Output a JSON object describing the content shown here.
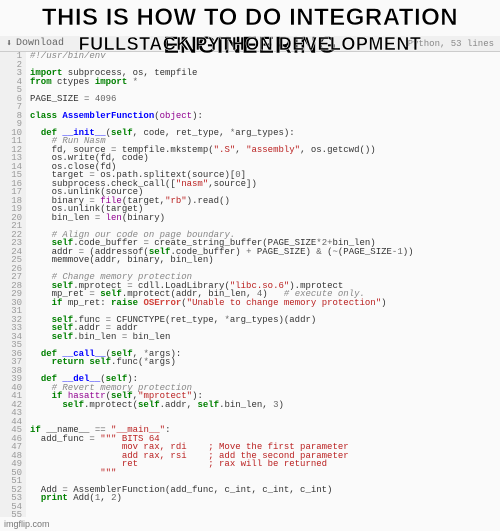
{
  "meme": {
    "line1": "THIS IS HOW TO DO INTEGRATION ENGINEERING",
    "line2": "FULLSTACK PYTHON DEVELOPMENT"
  },
  "toolbar": {
    "download_label": "Download",
    "lang_label": "Python, 53 lines"
  },
  "code": {
    "lines": [
      {
        "n": 1,
        "html": "<span class=\"c-comment\">#!/usr/bin/env</span>"
      },
      {
        "n": 2,
        "html": ""
      },
      {
        "n": 3,
        "html": "<span class=\"c-keyword\">import</span> subprocess, os, tempfile"
      },
      {
        "n": 4,
        "html": "<span class=\"c-keyword\">from</span> ctypes <span class=\"c-keyword\">import</span> <span class=\"c-op\">*</span>"
      },
      {
        "n": 5,
        "html": ""
      },
      {
        "n": 6,
        "html": "PAGE_SIZE <span class=\"c-op\">=</span> <span class=\"c-number\">4096</span>"
      },
      {
        "n": 7,
        "html": ""
      },
      {
        "n": 8,
        "html": "<span class=\"c-keyword\">class</span> <span class=\"c-class\">AssemblerFunction</span>(<span class=\"c-builtin\">object</span>):"
      },
      {
        "n": 9,
        "html": ""
      },
      {
        "n": 10,
        "html": "  <span class=\"c-keyword\">def</span> <span class=\"c-def\">__init__</span>(<span class=\"c-self\">self</span>, code, ret_type, <span class=\"c-op\">*</span>arg_types):"
      },
      {
        "n": 11,
        "html": "    <span class=\"c-comment\"># Run Nasm</span>"
      },
      {
        "n": 12,
        "html": "    fd, source <span class=\"c-op\">=</span> tempfile.mkstemp(<span class=\"c-string\">\".S\"</span>, <span class=\"c-string\">\"assembly\"</span>, os.getcwd())"
      },
      {
        "n": 13,
        "html": "    os.write(fd, code)"
      },
      {
        "n": 14,
        "html": "    os.close(fd)"
      },
      {
        "n": 15,
        "html": "    target <span class=\"c-op\">=</span> os.path.splitext(source)[<span class=\"c-number\">0</span>]"
      },
      {
        "n": 16,
        "html": "    subprocess.check_call([<span class=\"c-string\">\"nasm\"</span>,source])"
      },
      {
        "n": 17,
        "html": "    os.unlink(source)"
      },
      {
        "n": 18,
        "html": "    binary <span class=\"c-op\">=</span> <span class=\"c-builtin\">file</span>(target,<span class=\"c-string\">\"rb\"</span>).read()"
      },
      {
        "n": 19,
        "html": "    os.unlink(target)"
      },
      {
        "n": 20,
        "html": "    bin_len <span class=\"c-op\">=</span> <span class=\"c-builtin\">len</span>(binary)"
      },
      {
        "n": 21,
        "html": ""
      },
      {
        "n": 22,
        "html": "    <span class=\"c-comment\"># Align our code on page boundary.</span>"
      },
      {
        "n": 23,
        "html": "    <span class=\"c-self\">self</span>.code_buffer <span class=\"c-op\">=</span> create_string_buffer(PAGE_SIZE<span class=\"c-op\">*</span><span class=\"c-number\">2</span><span class=\"c-op\">+</span>bin_len)"
      },
      {
        "n": 24,
        "html": "    addr <span class=\"c-op\">=</span> (addressof(<span class=\"c-self\">self</span>.code_buffer) <span class=\"c-op\">+</span> PAGE_SIZE) <span class=\"c-op\">&amp;</span> (<span class=\"c-op\">~</span>(PAGE_SIZE<span class=\"c-op\">-</span><span class=\"c-number\">1</span>))"
      },
      {
        "n": 25,
        "html": "    memmove(addr, binary, bin_len)"
      },
      {
        "n": 26,
        "html": ""
      },
      {
        "n": 27,
        "html": "    <span class=\"c-comment\"># Change memory protection</span>"
      },
      {
        "n": 28,
        "html": "    <span class=\"c-self\">self</span>.mprotect <span class=\"c-op\">=</span> cdll.LoadLibrary(<span class=\"c-string\">\"libc.so.6\"</span>).mprotect"
      },
      {
        "n": 29,
        "html": "    mp_ret <span class=\"c-op\">=</span> <span class=\"c-self\">self</span>.mprotect(addr, bin_len, <span class=\"c-number\">4</span>)   <span class=\"c-comment\"># execute only.</span>"
      },
      {
        "n": 30,
        "html": "    <span class=\"c-keyword\">if</span> mp_ret: <span class=\"c-keyword\">raise</span> <span class=\"c-error\">OSError</span>(<span class=\"c-string\">\"Unable to change memory protection\"</span>)"
      },
      {
        "n": 31,
        "html": ""
      },
      {
        "n": 32,
        "html": "    <span class=\"c-self\">self</span>.func <span class=\"c-op\">=</span> CFUNCTYPE(ret_type, <span class=\"c-op\">*</span>arg_types)(addr)"
      },
      {
        "n": 33,
        "html": "    <span class=\"c-self\">self</span>.addr <span class=\"c-op\">=</span> addr"
      },
      {
        "n": 34,
        "html": "    <span class=\"c-self\">self</span>.bin_len <span class=\"c-op\">=</span> bin_len"
      },
      {
        "n": 35,
        "html": ""
      },
      {
        "n": 36,
        "html": "  <span class=\"c-keyword\">def</span> <span class=\"c-def\">__call__</span>(<span class=\"c-self\">self</span>, <span class=\"c-op\">*</span>args):"
      },
      {
        "n": 37,
        "html": "    <span class=\"c-keyword\">return</span> <span class=\"c-self\">self</span>.func(<span class=\"c-op\">*</span>args)"
      },
      {
        "n": 38,
        "html": ""
      },
      {
        "n": 39,
        "html": "  <span class=\"c-keyword\">def</span> <span class=\"c-def\">__del__</span>(<span class=\"c-self\">self</span>):"
      },
      {
        "n": 40,
        "html": "    <span class=\"c-comment\"># Revert memory protection</span>"
      },
      {
        "n": 41,
        "html": "    <span class=\"c-keyword\">if</span> <span class=\"c-builtin\">hasattr</span>(<span class=\"c-self\">self</span>,<span class=\"c-string\">\"mprotect\"</span>):"
      },
      {
        "n": 42,
        "html": "      <span class=\"c-self\">self</span>.mprotect(<span class=\"c-self\">self</span>.addr, <span class=\"c-self\">self</span>.bin_len, <span class=\"c-number\">3</span>)"
      },
      {
        "n": 43,
        "html": ""
      },
      {
        "n": 44,
        "html": ""
      },
      {
        "n": 45,
        "html": "<span class=\"c-keyword\">if</span> __name__ <span class=\"c-op\">==</span> <span class=\"c-string\">\"__main__\"</span>:"
      },
      {
        "n": 46,
        "html": "  add_func <span class=\"c-op\">=</span> <span class=\"c-string\">\"\"\" BITS 64</span>"
      },
      {
        "n": 47,
        "html": "<span class=\"c-string\">                 mov rax, rdi    ; Move the first parameter</span>"
      },
      {
        "n": 48,
        "html": "<span class=\"c-string\">                 add rax, rsi    ; add the second parameter</span>"
      },
      {
        "n": 49,
        "html": "<span class=\"c-string\">                 ret             ; rax will be returned</span>"
      },
      {
        "n": 50,
        "html": "<span class=\"c-string\">             \"\"\"</span>"
      },
      {
        "n": 51,
        "html": ""
      },
      {
        "n": 52,
        "html": "  Add <span class=\"c-op\">=</span> AssemblerFunction(add_func, c_int, c_int, c_int)"
      },
      {
        "n": 53,
        "html": "  <span class=\"c-keyword\">print</span> Add(<span class=\"c-number\">1</span>, <span class=\"c-number\">2</span>)"
      },
      {
        "n": 54,
        "html": ""
      },
      {
        "n": 55,
        "html": ""
      }
    ]
  },
  "watermark": "imgflip.com"
}
